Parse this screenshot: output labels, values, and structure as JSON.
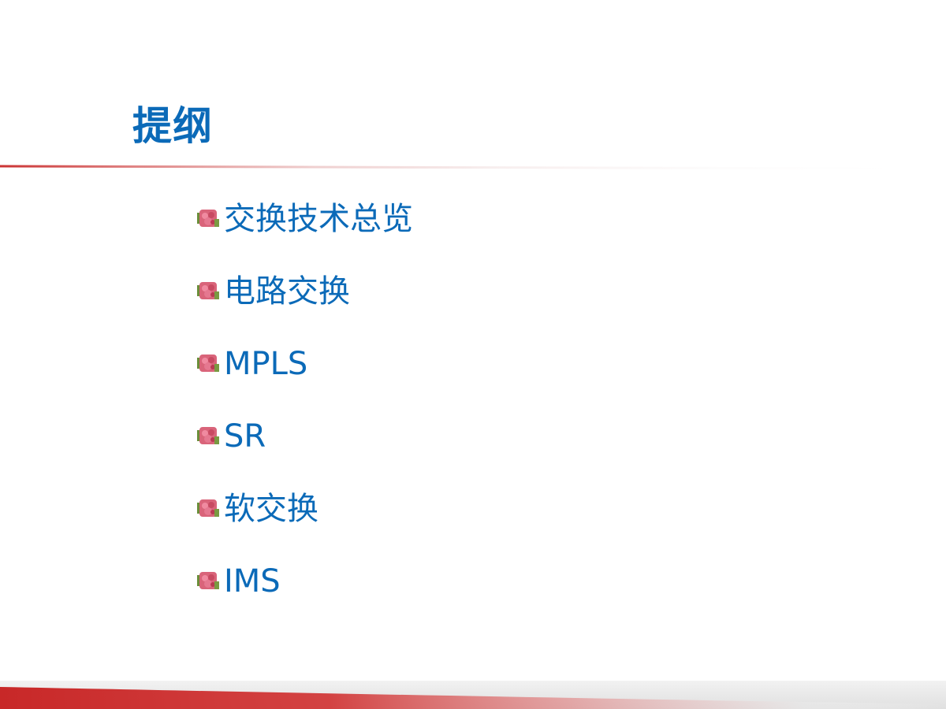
{
  "slide": {
    "title": "提纲",
    "bullets": [
      {
        "label": "交换技术总览"
      },
      {
        "label": "电路交换"
      },
      {
        "label": "MPLS"
      },
      {
        "label": "SR"
      },
      {
        "label": "软交换"
      },
      {
        "label": "IMS"
      }
    ],
    "bullet_icon": "flower-bullet-icon"
  },
  "colors": {
    "accent_blue": "#0b6ab8",
    "accent_red": "#c82828",
    "band_gray": "#e0e0e0"
  }
}
